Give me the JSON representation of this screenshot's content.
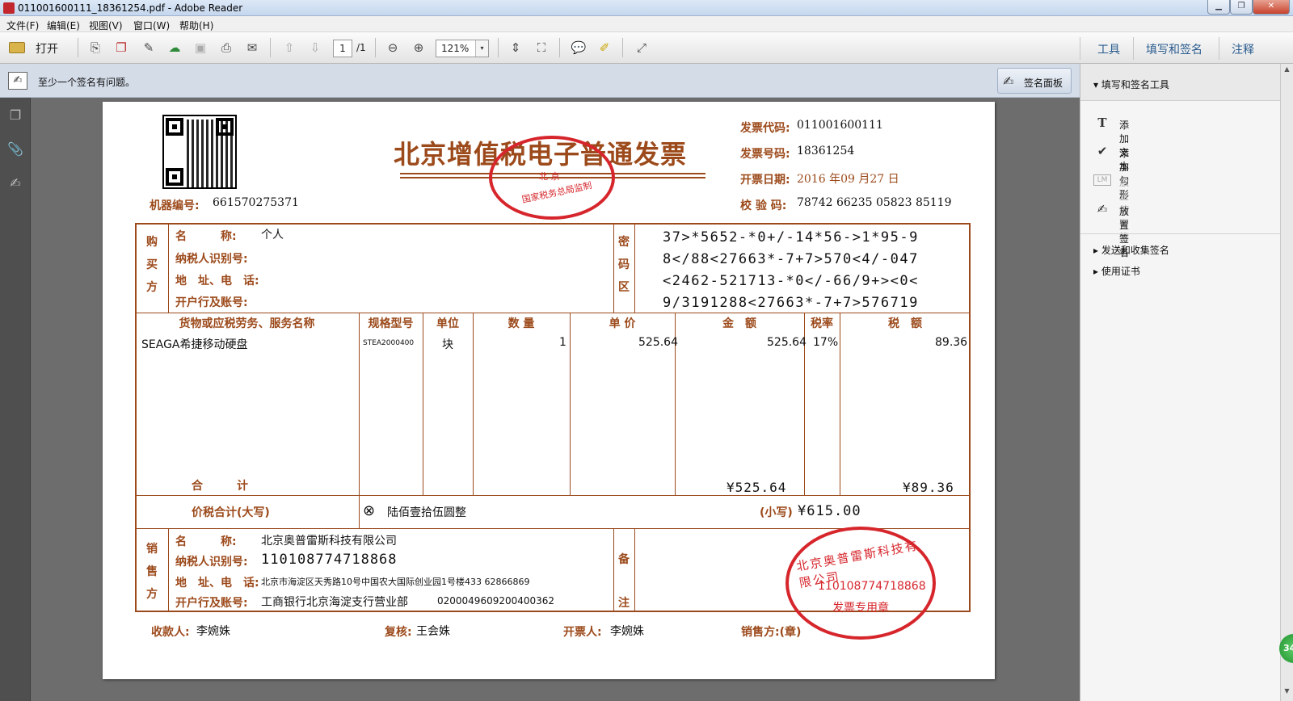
{
  "window": {
    "title": "011001600111_18361254.pdf - Adobe Reader",
    "minimize": "▁",
    "maximize": "❐",
    "close": "✕"
  },
  "menu": [
    "文件(F)",
    "编辑(E)",
    "视图(V)",
    "窗口(W)",
    "帮助(H)"
  ],
  "toolbar": {
    "open_label": "打开",
    "page_current": "1",
    "page_total": "/1",
    "zoom": "121%",
    "zoom_dropdown": "▾",
    "right_tabs": [
      "工具",
      "填写和签名",
      "注释"
    ],
    "icons": [
      "create-pdf-icon",
      "combine-icon",
      "edit-icon",
      "upload-cloud-icon",
      "save-icon",
      "print-icon",
      "email-icon",
      "prev-page-icon",
      "next-page-icon",
      "zoom-out-icon",
      "zoom-in-icon",
      "fit-width-icon",
      "fit-page-icon",
      "comment-icon",
      "highlight-icon",
      "fullscreen-icon"
    ]
  },
  "message_bar": {
    "text": "至少一个签名有问题。",
    "sig_panel_label": "签名面板"
  },
  "tools_pane": {
    "header": "▾ 填写和签名工具",
    "items": [
      {
        "icon": "T",
        "label": "添加文本",
        "enabled": true
      },
      {
        "icon": "✔",
        "label": "添加勾形",
        "enabled": true
      },
      {
        "icon": "LM",
        "label": "放置缩写签名",
        "enabled": false
      },
      {
        "icon": "✍",
        "label": "放置签名",
        "enabled": true
      }
    ],
    "sections": [
      "▸ 发送和收集签名",
      "▸ 使用证书"
    ]
  },
  "badge": "34",
  "invoice": {
    "title": "北京增值税电子普通发票",
    "code_label": "发票代码:",
    "code": "011001600111",
    "number_label": "发票号码:",
    "number": "18361254",
    "date_label": "开票日期:",
    "date": "2016 年09 月27 日",
    "check_label": "校 验 码:",
    "check": "78742 66235 05823 85119",
    "machine_label": "机器编号:",
    "machine": "661570275371",
    "buyer": {
      "side_label": [
        "购",
        "买",
        "方"
      ],
      "name_label": "名　　　称:",
      "name": "个人",
      "tax_id_label": "纳税人识别号:",
      "address_label": "地　址、电　话:",
      "bank_label": "开户行及账号:"
    },
    "cipher_label": [
      "密",
      "码",
      "区"
    ],
    "cipher": [
      "37>*5652-*0+/-14*56->1*95-9",
      "8</88<27663*-7+7>570<4/-047",
      "<2462-521713-*0</-66/9+><0<",
      "9/3191288<27663*-7+7>576719"
    ],
    "columns": [
      "货物或应税劳务、服务名称",
      "规格型号",
      "单位",
      "数 量",
      "单 价",
      "金　额",
      "税率",
      "税　额"
    ],
    "items": [
      {
        "name": "SEAGA希捷移动硬盘",
        "spec": "STEA2000400",
        "unit": "块",
        "qty": "1",
        "price": "525.64",
        "amount": "525.64",
        "rate": "17%",
        "tax": "89.36"
      }
    ],
    "total_label": "合　　　计",
    "total_amount": "¥525.64",
    "total_tax": "¥89.36",
    "grand_label": "价税合计(大写)",
    "grand_circle": "⊗",
    "grand_words": "陆佰壹拾伍圆整",
    "grand_small_label": "(小写)",
    "grand_small": "¥615.00",
    "seller": {
      "side_label": [
        "销",
        "售",
        "方"
      ],
      "name_label": "名　　　称:",
      "name": "北京奥普雷斯科技有限公司",
      "tax_id_label": "纳税人识别号:",
      "tax_id": "110108774718868",
      "address_label": "地　址、电　话:",
      "address": "北京市海淀区天秀路10号中国农大国际创业园1号楼433 62866869",
      "bank_label": "开户行及账号:",
      "bank": "工商银行北京海淀支行营业部",
      "bank_account": "0200049609200400362"
    },
    "remark_label": [
      "备",
      "注"
    ],
    "payee_label": "收款人:",
    "payee": "李婉姝",
    "reviewer_label": "复核:",
    "reviewer": "王会姝",
    "drawer_label": "开票人:",
    "drawer": "李婉姝",
    "seller_seal_label": "销售方:(章)",
    "stamp_top": {
      "line1": "国家税务总局监制",
      "line2": "北  京"
    },
    "stamp_seller": {
      "ring": "北京奥普雷斯科技有限公司",
      "tax_id": "110108774718868",
      "text": "发票专用章"
    }
  }
}
